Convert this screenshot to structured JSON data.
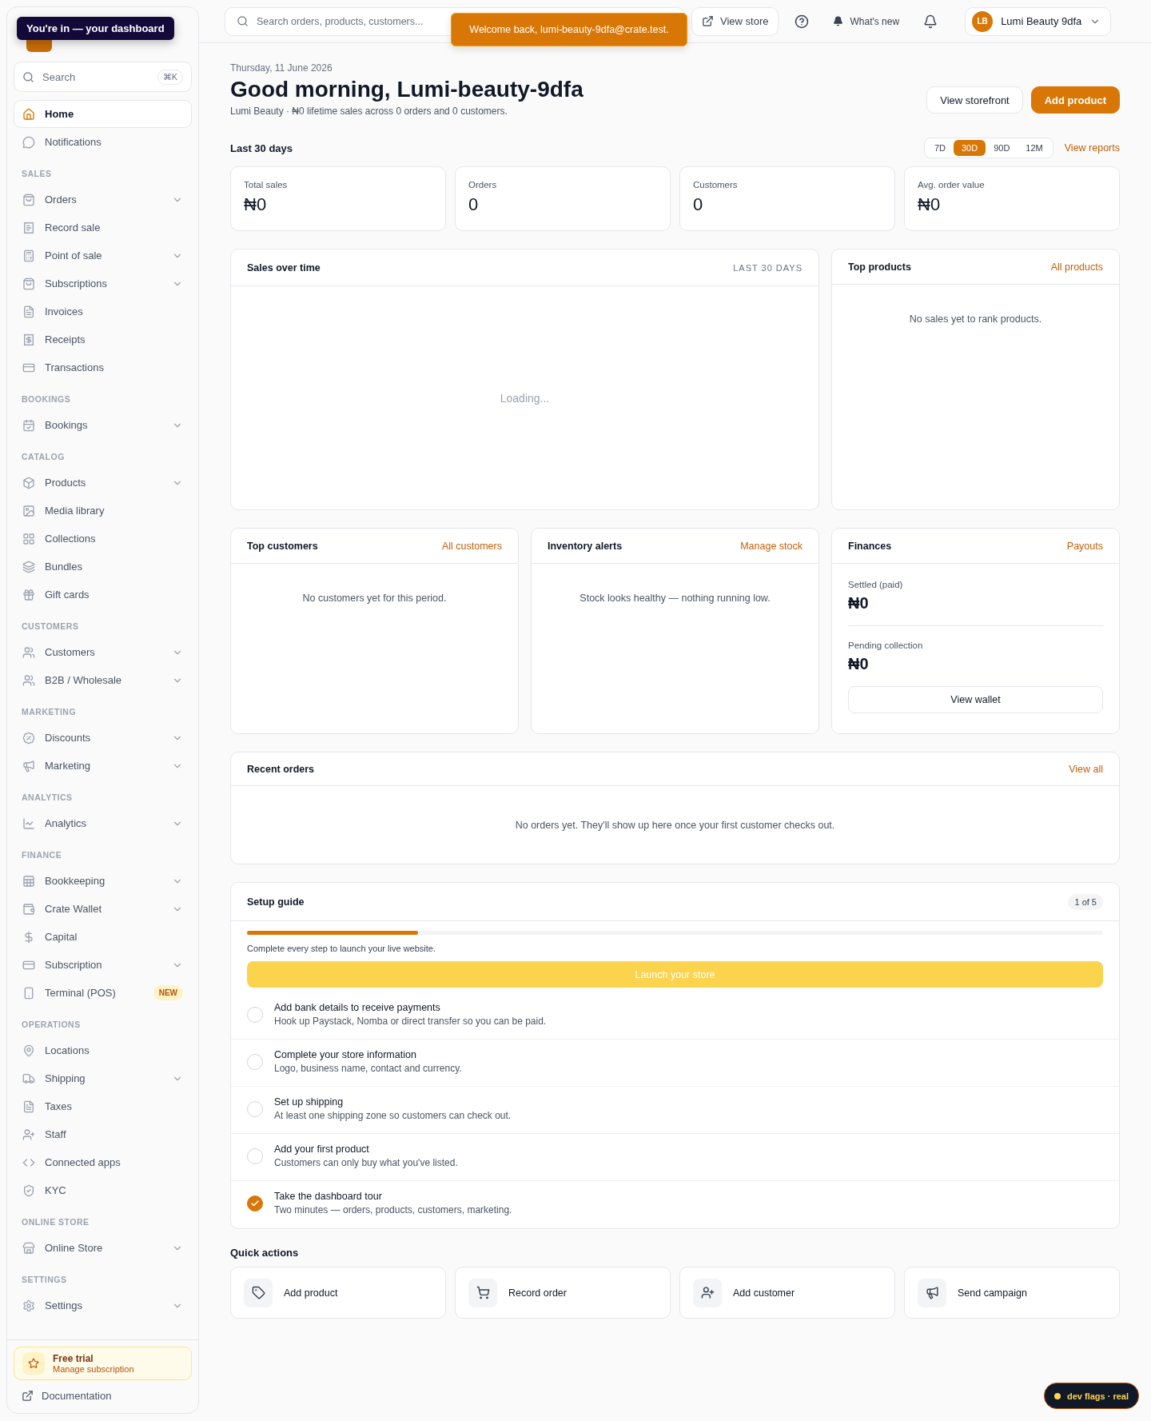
{
  "tooltip": "You're in — your dashboard",
  "sidebar": {
    "search": {
      "placeholder": "Search",
      "shortcut": "⌘K"
    },
    "sections": [
      {
        "items": [
          {
            "label": "Home",
            "selected": true,
            "expandable": false
          },
          {
            "label": "Notifications",
            "selected": false,
            "expandable": false
          }
        ]
      },
      {
        "title": "SALES",
        "items": [
          {
            "label": "Orders",
            "selected": false,
            "expandable": true
          },
          {
            "label": "Record sale",
            "selected": false,
            "expandable": false
          },
          {
            "label": "Point of sale",
            "selected": false,
            "expandable": true
          },
          {
            "label": "Subscriptions",
            "selected": false,
            "expandable": true
          },
          {
            "label": "Invoices",
            "selected": false,
            "expandable": false
          },
          {
            "label": "Receipts",
            "selected": false,
            "expandable": false
          },
          {
            "label": "Transactions",
            "selected": false,
            "expandable": false
          }
        ]
      },
      {
        "title": "BOOKINGS",
        "items": [
          {
            "label": "Bookings",
            "selected": false,
            "expandable": true
          }
        ]
      },
      {
        "title": "CATALOG",
        "items": [
          {
            "label": "Products",
            "selected": false,
            "expandable": true
          },
          {
            "label": "Media library",
            "selected": false,
            "expandable": false
          },
          {
            "label": "Collections",
            "selected": false,
            "expandable": false
          },
          {
            "label": "Bundles",
            "selected": false,
            "expandable": false
          },
          {
            "label": "Gift cards",
            "selected": false,
            "expandable": false
          }
        ]
      },
      {
        "title": "CUSTOMERS",
        "items": [
          {
            "label": "Customers",
            "selected": false,
            "expandable": true
          },
          {
            "label": "B2B / Wholesale",
            "selected": false,
            "expandable": true
          }
        ]
      },
      {
        "title": "MARKETING",
        "items": [
          {
            "label": "Discounts",
            "selected": false,
            "expandable": true
          },
          {
            "label": "Marketing",
            "selected": false,
            "expandable": true
          }
        ]
      },
      {
        "title": "ANALYTICS",
        "items": [
          {
            "label": "Analytics",
            "selected": false,
            "expandable": true
          }
        ]
      },
      {
        "title": "FINANCE",
        "items": [
          {
            "label": "Bookkeeping",
            "selected": false,
            "expandable": true
          },
          {
            "label": "Crate Wallet",
            "selected": false,
            "expandable": true
          },
          {
            "label": "Capital",
            "selected": false,
            "expandable": false
          },
          {
            "label": "Subscription",
            "selected": false,
            "expandable": true
          },
          {
            "label": "Terminal (POS)",
            "selected": false,
            "expandable": false,
            "badge": "NEW"
          }
        ]
      },
      {
        "title": "OPERATIONS",
        "items": [
          {
            "label": "Locations",
            "selected": false,
            "expandable": false
          },
          {
            "label": "Shipping",
            "selected": false,
            "expandable": true
          },
          {
            "label": "Taxes",
            "selected": false,
            "expandable": false
          },
          {
            "label": "Staff",
            "selected": false,
            "expandable": false
          },
          {
            "label": "Connected apps",
            "selected": false,
            "expandable": false
          },
          {
            "label": "KYC",
            "selected": false,
            "expandable": false
          }
        ]
      },
      {
        "title": "ONLINE STORE",
        "items": [
          {
            "label": "Online Store",
            "selected": false,
            "expandable": true
          }
        ]
      },
      {
        "title": "SETTINGS",
        "items": [
          {
            "label": "Settings",
            "selected": false,
            "expandable": true
          }
        ]
      }
    ],
    "trial": {
      "title": "Free trial",
      "subtitle": "Manage subscription"
    },
    "documentation": "Documentation"
  },
  "topbar": {
    "search_placeholder": "Search orders, products, customers...",
    "view_store": "View store",
    "whats_new": "What's new",
    "account": {
      "initials": "LB",
      "name": "Lumi Beauty 9dfa"
    }
  },
  "toast": "Welcome back, lumi-beauty-9dfa@crate.test.",
  "header": {
    "date": "Thursday, 11 June 2026",
    "title": "Good morning, Lumi-beauty-9dfa",
    "subtitle": "Lumi Beauty · ₦0 lifetime sales across 0 orders and 0 customers.",
    "buttons": [
      {
        "label": "View storefront",
        "kind": "secondary"
      },
      {
        "label": "Add product",
        "kind": "primary"
      }
    ]
  },
  "period": {
    "label": "Last 30 days",
    "ranges": [
      {
        "label": "7D",
        "selected": false
      },
      {
        "label": "30D",
        "selected": true
      },
      {
        "label": "90D",
        "selected": false
      },
      {
        "label": "12M",
        "selected": false
      }
    ],
    "link": "View reports"
  },
  "stats": [
    {
      "label": "Total sales",
      "value": "₦0"
    },
    {
      "label": "Orders",
      "value": "0"
    },
    {
      "label": "Customers",
      "value": "0"
    },
    {
      "label": "Avg. order value",
      "value": "₦0"
    }
  ],
  "sales_over_time": {
    "title": "Sales over time",
    "range": "LAST 30 DAYS",
    "status": "Loading..."
  },
  "top_products": {
    "title": "Top products",
    "link": "All products",
    "empty": "No sales yet to rank products."
  },
  "top_customers": {
    "title": "Top customers",
    "link": "All customers",
    "empty": "No customers yet for this period."
  },
  "inventory_alerts": {
    "title": "Inventory alerts",
    "link": "Manage stock",
    "empty": "Stock looks healthy — nothing running low."
  },
  "finances": {
    "title": "Finances",
    "link": "Payouts",
    "rows": [
      {
        "label": "Settled (paid)",
        "value": "₦0"
      },
      {
        "label": "Pending collection",
        "value": "₦0"
      }
    ],
    "button": "View wallet"
  },
  "recent_orders": {
    "title": "Recent orders",
    "link": "View all",
    "empty": "No orders yet. They'll show up here once your first customer checks out."
  },
  "setup_guide": {
    "title": "Setup guide",
    "count": "1 of 5",
    "level": 0.2,
    "note": "Complete every step to launch your live website.",
    "button": {
      "label": "Launch your store",
      "disabled": true
    },
    "steps": [
      {
        "title": "Add bank details to receive payments",
        "description": "Hook up Paystack, Nomba or direct transfer so you can be paid.",
        "done": false
      },
      {
        "title": "Complete your store information",
        "description": "Logo, business name, contact and currency.",
        "done": false
      },
      {
        "title": "Set up shipping",
        "description": "At least one shipping zone so customers can check out.",
        "done": false
      },
      {
        "title": "Add your first product",
        "description": "Customers can only buy what you've listed.",
        "done": false
      },
      {
        "title": "Take the dashboard tour",
        "description": "Two minutes — orders, products, customers, marketing.",
        "done": true
      }
    ]
  },
  "quick_actions": {
    "title": "Quick actions",
    "items": [
      "Add product",
      "Record order",
      "Add customer",
      "Send campaign"
    ]
  },
  "dev_badge": "dev flags · real"
}
